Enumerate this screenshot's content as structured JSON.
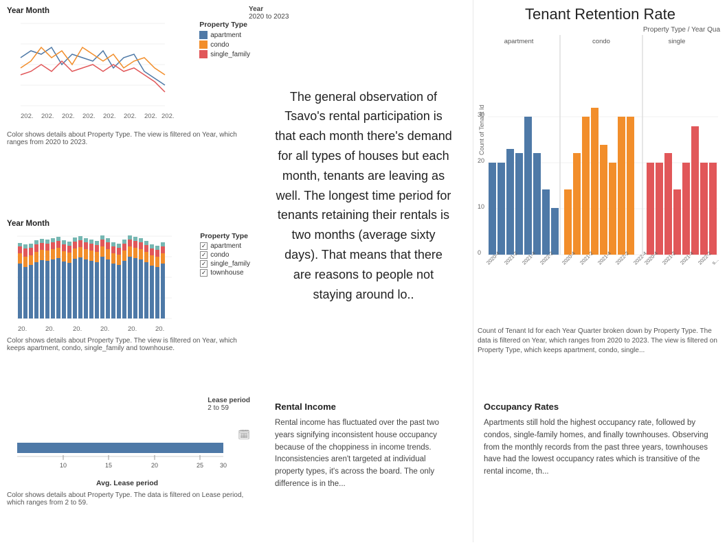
{
  "header": {
    "tenant_retention_title": "Tenant Retention Rate",
    "year_filter_label": "Year",
    "year_filter_value": "2020 to 2023",
    "property_type_label": "Property Type / Year Qua"
  },
  "top_left_chart": {
    "title": "Year Month",
    "subtitle": "Color shows details about Property Type. The view is filtered on Year, which ranges from 2020 to 2023.",
    "legend_title": "Property Type",
    "items": [
      "apartment",
      "condo",
      "single_family"
    ],
    "colors": [
      "#4e79a7",
      "#f28e2b",
      "#e15759"
    ]
  },
  "mid_left_chart": {
    "title": "Year Month",
    "subtitle": "Color shows details about Property Type. The view is filtered on Year, which keeps apartment, condo, single_family and townhouse.",
    "legend_title": "Property Type",
    "items": [
      "apartment",
      "condo",
      "single_family",
      "townhouse"
    ],
    "colors": [
      "#4e79a7",
      "#f28e2b",
      "#e15759",
      "#76b7b2"
    ]
  },
  "bot_left_chart": {
    "lease_period_label": "Lease period",
    "lease_period_value": "2 to 59",
    "x_axis_label": "Avg. Lease period",
    "x_ticks": [
      "10",
      "15",
      "20",
      "25",
      "30"
    ],
    "subtitle": "Color shows details about Property Type. The data is filtered on Lease period, which ranges from 2 to 59."
  },
  "text_panel": {
    "content": "The general observation of Tsavo's rental participation is that each month there's demand for all types of houses but each month, tenants are leaving as well. The longest time period for tenants retaining their rentals is two months (average sixty days). That means that there are reasons to people not staying around lo.."
  },
  "rental_income": {
    "title": "Rental Income",
    "content": "Rental income has fluctuated over the past two years signifying inconsistent house occupancy because of the choppiness in income trends. Inconsistencies aren't targeted at individual property types, it's across the board. The only difference is in the..."
  },
  "occupancy": {
    "title": "Occupancy Rates",
    "content": "Apartments still hold the highest occupancy rate, followed by condos, single-family homes, and finally townhouses. Observing from the monthly records from the past three years, townhouses have had the lowest occupancy rates which is transitive of the rental income, th..."
  },
  "tenant_chart": {
    "y_axis_label": "Count of Tenant Id",
    "x_categories": [
      "apartment",
      "condo",
      "single"
    ],
    "bar_colors": {
      "apartment": "#4e79a7",
      "condo": "#f28e2b",
      "single_family": "#e15759"
    },
    "y_ticks": [
      "0",
      "10",
      "20",
      "30"
    ],
    "caption": "Count of Tenant Id for each Year Quarter broken down by Property Type. The data is filtered on Year, which ranges from 2020 to 2023. The view is filtered on Property Type, which keeps apartment, condo, single..."
  }
}
